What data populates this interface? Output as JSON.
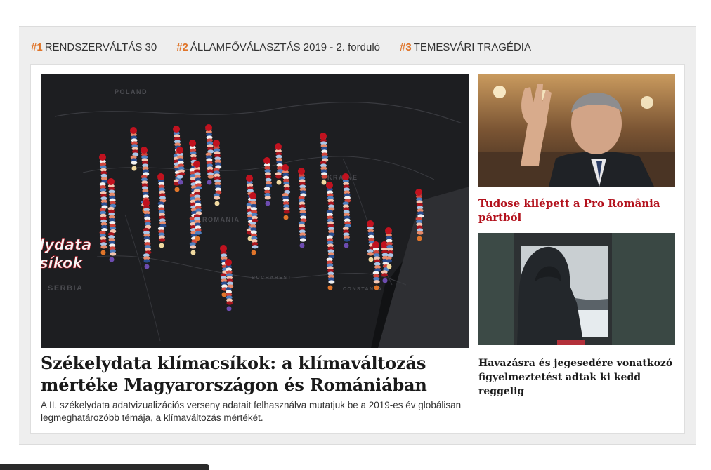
{
  "trending": [
    {
      "num": "#1",
      "label": "RENDSZERVÁLTÁS 30"
    },
    {
      "num": "#2",
      "label": "ÁLLAMFŐVÁLASZTÁS 2019 - 2. forduló"
    },
    {
      "num": "#3",
      "label": "TEMESVÁRI TRAGÉDIA"
    }
  ],
  "main": {
    "title": "Székelydata klímacsíkok: a klímaváltozás mértéke Magyarországon és Romániában",
    "lead": "A II. székelydata adatvizualizációs verseny adatait felhasználva mutatjuk be a 2019-es év globálisan legmeghatározóbb témája, a klímaváltozás mértékét.",
    "image": {
      "overlay_line1": "lydata",
      "overlay_line2": "síkok",
      "map_labels": [
        "POLAND",
        "UKRAINE",
        "ROMANIA",
        "SERBIA",
        "BUCHAREST",
        "CONSTANTA"
      ]
    }
  },
  "side": [
    {
      "title": "Tudose kilépett a Pro România pártból",
      "image_alt": "man-raising-hand-in-parliament"
    },
    {
      "title": "Havazásra és jegesedére vonatkozó figyelmeztetést adtak ki kedd reggelig",
      "image_alt": "hooded-person-at-train-window"
    }
  ],
  "colors": {
    "accent": "#e0752a",
    "headline_red": "#b3111c",
    "panel_bg": "#eeeeee"
  }
}
